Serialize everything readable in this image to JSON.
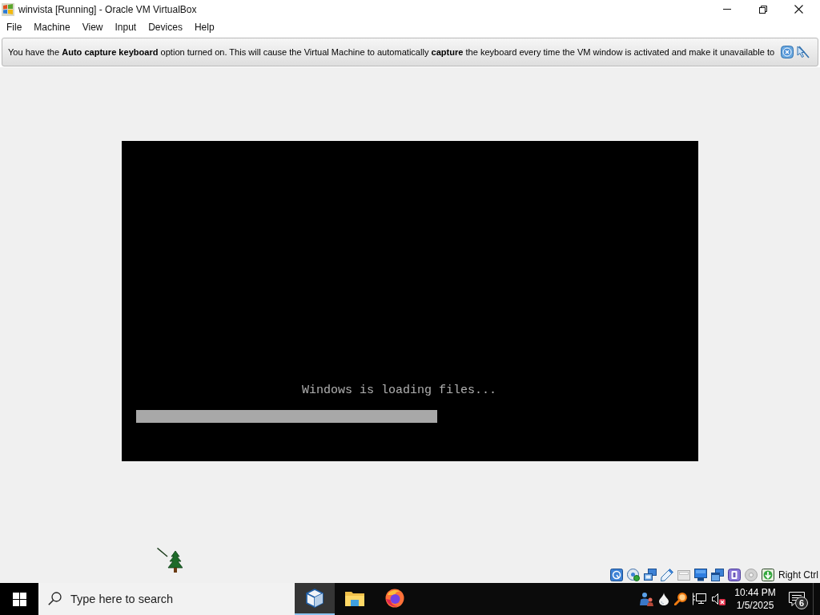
{
  "window": {
    "title": "winvista [Running] - Oracle VM VirtualBox"
  },
  "menu_bar": {
    "items": [
      "File",
      "Machine",
      "View",
      "Input",
      "Devices",
      "Help"
    ]
  },
  "notification": {
    "message": "You have the **Auto capture keyboard** option turned on. This will cause the Virtual Machine to automatically **capture** the keyboard every time the VM window is activated and make it unavailable to"
  },
  "vm_screen": {
    "message": "Windows is loading files...",
    "progress": {
      "level": 0.55
    }
  },
  "status_bar": {
    "host_key": "Right Ctrl"
  },
  "taskbar": {
    "search": {
      "placeholder": "Type here to search"
    },
    "apps": [
      {
        "kind": "virtualbox",
        "selected": true
      },
      {
        "kind": "file-explorer",
        "selected": false
      },
      {
        "kind": "firefox",
        "selected": false
      }
    ],
    "clock": {
      "time": "10:44 PM",
      "date": "1/5/2025"
    },
    "notifications": {
      "count": "6"
    }
  }
}
